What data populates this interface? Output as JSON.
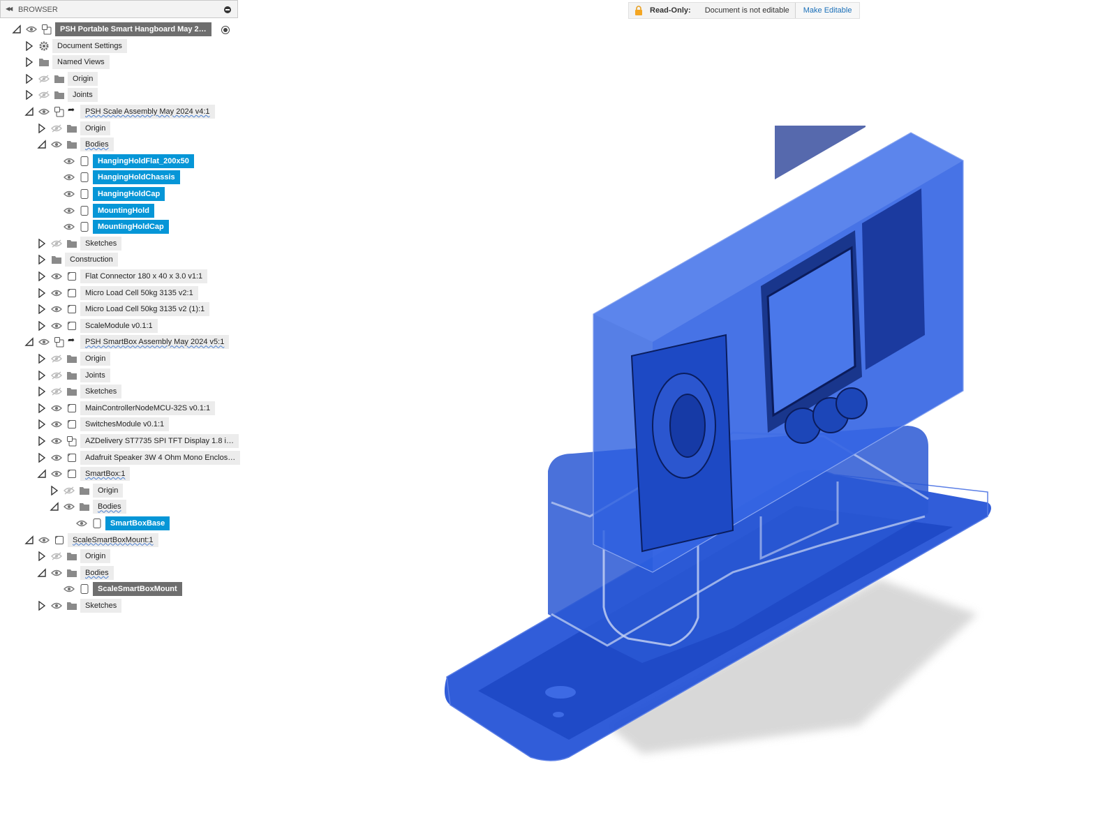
{
  "browser": {
    "title": "BROWSER",
    "tree": [
      {
        "label": "PSH Portable Smart Hangboard May 2…",
        "icon": "component-icon",
        "state": "expanded",
        "eye": "visible",
        "style": "root"
      },
      {
        "label": "Document Settings",
        "icon": "gear-icon",
        "state": "collapsed",
        "eye": "none"
      },
      {
        "label": "Named Views",
        "icon": "folder-icon",
        "state": "collapsed",
        "eye": "none"
      },
      {
        "label": "Origin",
        "icon": "folder-icon",
        "state": "collapsed",
        "eye": "hidden"
      },
      {
        "label": "Joints",
        "icon": "folder-icon",
        "state": "collapsed",
        "eye": "hidden"
      },
      {
        "label": "PSH Scale Assembly May 2024 v4:1",
        "icon": "component-icon",
        "state": "expanded",
        "eye": "visible",
        "link": true,
        "wavy": true
      },
      {
        "label": "Origin",
        "icon": "folder-icon",
        "state": "collapsed",
        "eye": "hidden"
      },
      {
        "label": "Bodies",
        "icon": "folder-icon",
        "state": "expanded",
        "eye": "visible",
        "wavy": true
      },
      {
        "label": "HangingHoldFlat_200x50",
        "icon": "body-icon",
        "state": "leaf",
        "eye": "visible",
        "style": "sel"
      },
      {
        "label": "HangingHoldChassis",
        "icon": "body-icon",
        "state": "leaf",
        "eye": "visible",
        "style": "sel"
      },
      {
        "label": "HangingHoldCap",
        "icon": "body-icon",
        "state": "leaf",
        "eye": "visible",
        "style": "sel"
      },
      {
        "label": "MountingHold",
        "icon": "body-icon",
        "state": "leaf",
        "eye": "visible",
        "style": "sel"
      },
      {
        "label": "MountingHoldCap",
        "icon": "body-icon",
        "state": "leaf",
        "eye": "visible",
        "style": "sel"
      },
      {
        "label": "Sketches",
        "icon": "folder-icon",
        "state": "collapsed",
        "eye": "hidden"
      },
      {
        "label": "Construction",
        "icon": "folder-icon",
        "state": "collapsed",
        "eye": "none"
      },
      {
        "label": "Flat Connector 180 x 40 x 3.0 v1:1",
        "icon": "component-box-icon",
        "state": "collapsed",
        "eye": "visible"
      },
      {
        "label": "Micro Load Cell 50kg 3135 v2:1",
        "icon": "component-box-icon",
        "state": "collapsed",
        "eye": "visible"
      },
      {
        "label": "Micro Load Cell 50kg 3135 v2 (1):1",
        "icon": "component-box-icon",
        "state": "collapsed",
        "eye": "visible"
      },
      {
        "label": "ScaleModule v0.1:1",
        "icon": "component-box-icon",
        "state": "collapsed",
        "eye": "visible"
      },
      {
        "label": "PSH SmartBox Assembly May 2024 v5:1",
        "icon": "component-icon",
        "state": "expanded",
        "eye": "visible",
        "link": true,
        "wavy": true
      },
      {
        "label": "Origin",
        "icon": "folder-icon",
        "state": "collapsed",
        "eye": "hidden"
      },
      {
        "label": "Joints",
        "icon": "folder-icon",
        "state": "collapsed",
        "eye": "hidden"
      },
      {
        "label": "Sketches",
        "icon": "folder-icon",
        "state": "collapsed",
        "eye": "hidden"
      },
      {
        "label": "MainControllerNodeMCU-32S v0.1:1",
        "icon": "component-box-icon",
        "state": "collapsed",
        "eye": "visible"
      },
      {
        "label": "SwitchesModule v0.1:1",
        "icon": "component-box-icon",
        "state": "collapsed",
        "eye": "visible"
      },
      {
        "label": "AZDelivery ST7735 SPI TFT Display 1.8 i…",
        "icon": "component-icon",
        "state": "collapsed",
        "eye": "visible"
      },
      {
        "label": "Adafruit Speaker 3W 4 Ohm Mono Enclos…",
        "icon": "component-box-icon",
        "state": "collapsed",
        "eye": "visible"
      },
      {
        "label": "SmartBox:1",
        "icon": "component-box-icon",
        "state": "expanded",
        "eye": "visible",
        "wavy": true
      },
      {
        "label": "Origin",
        "icon": "folder-icon",
        "state": "collapsed",
        "eye": "hidden"
      },
      {
        "label": "Bodies",
        "icon": "folder-icon",
        "state": "expanded",
        "eye": "visible",
        "wavy": true
      },
      {
        "label": "SmartBoxBase",
        "icon": "body-icon",
        "state": "leaf",
        "eye": "visible",
        "style": "sel"
      },
      {
        "label": "ScaleSmartBoxMount:1",
        "icon": "component-box-icon",
        "state": "expanded",
        "eye": "visible",
        "wavy": true
      },
      {
        "label": "Origin",
        "icon": "folder-icon",
        "state": "collapsed",
        "eye": "hidden"
      },
      {
        "label": "Bodies",
        "icon": "folder-icon",
        "state": "expanded",
        "eye": "visible",
        "wavy": true
      },
      {
        "label": "ScaleSmartBoxMount",
        "icon": "body-icon",
        "state": "leaf",
        "eye": "visible",
        "style": "sel-gray"
      },
      {
        "label": "Sketches",
        "icon": "folder-icon",
        "state": "collapsed",
        "eye": "visible"
      }
    ]
  },
  "banner": {
    "lock_icon": "lock-icon",
    "readonly_label": "Read-Only:",
    "message": "Document is not editable",
    "action_label": "Make Editable"
  },
  "colors": {
    "selection": "#0696d7",
    "model_blue": "#2f5fd8",
    "link": "#1a6fb8"
  }
}
